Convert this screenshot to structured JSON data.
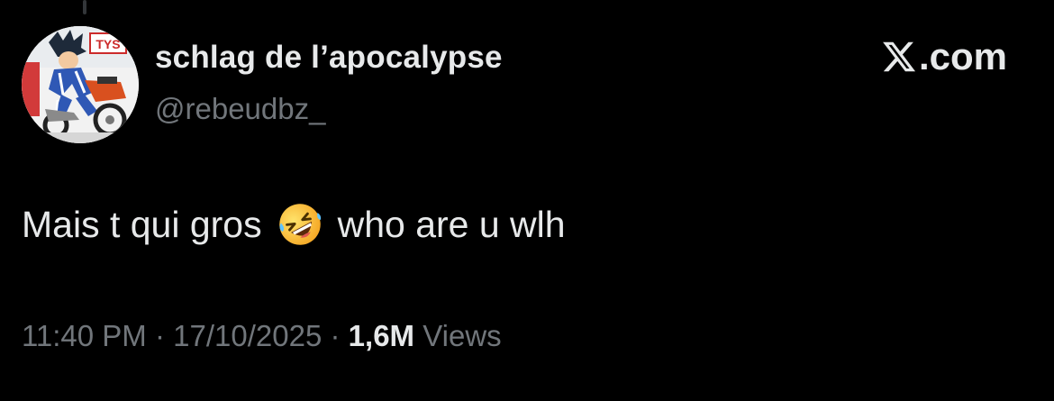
{
  "author": {
    "display_name": "schlag de l’apocalypse",
    "handle": "@rebeudbz_",
    "avatar_sign_text": "TYS"
  },
  "brand": {
    "logo_icon": "x-logo-icon",
    "suffix": ".com"
  },
  "tweet": {
    "text_before_emoji": "Mais t qui gros",
    "emoji": "rolling-on-the-floor-laughing-emoji",
    "text_after_emoji": "who are u wlh"
  },
  "meta": {
    "time": "11:40 PM",
    "separator": "·",
    "date": "17/10/2025",
    "views_count": "1,6M",
    "views_label": "Views"
  },
  "colors": {
    "background": "#000000",
    "primary_text": "#e7e9ea",
    "secondary_text": "#71767b"
  }
}
